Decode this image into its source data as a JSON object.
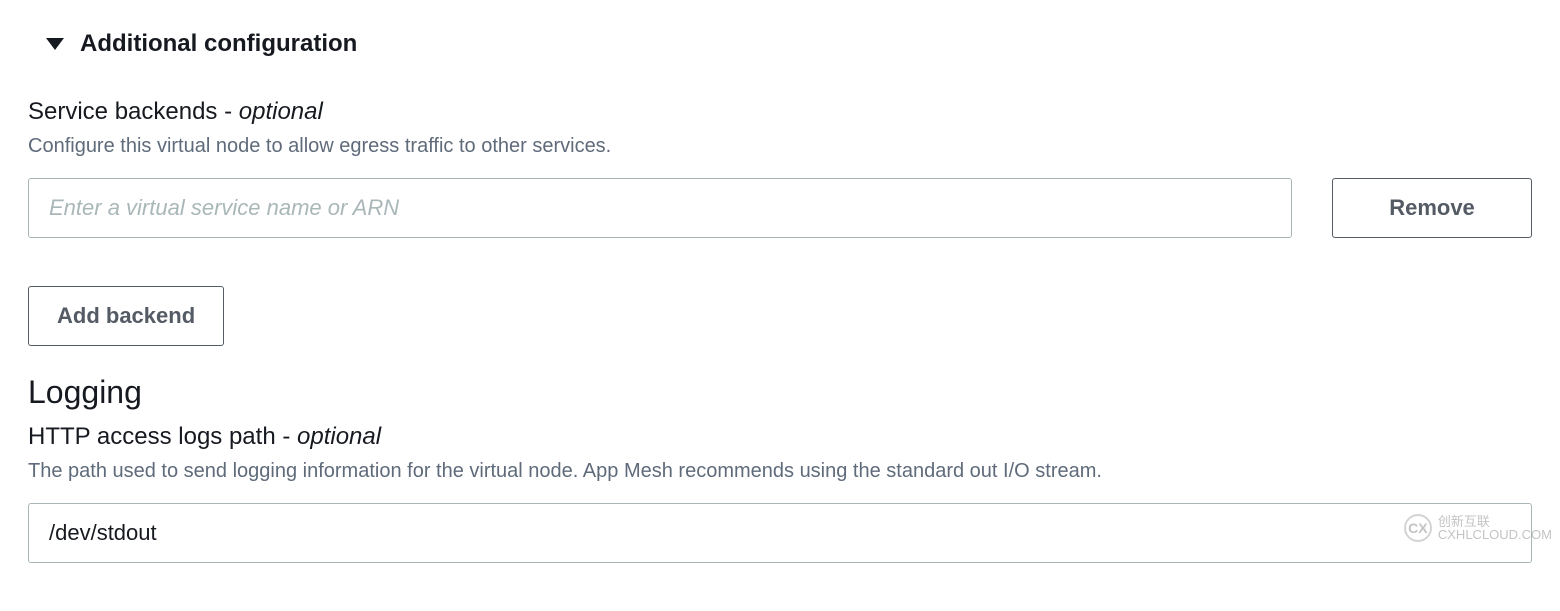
{
  "expander": {
    "title": "Additional configuration"
  },
  "backends": {
    "label_main": "Service backends - ",
    "label_optional": "optional",
    "description": "Configure this virtual node to allow egress traffic to other services.",
    "input_placeholder": "Enter a virtual service name or ARN",
    "input_value": "",
    "remove_label": "Remove",
    "add_label": "Add backend"
  },
  "logging": {
    "heading": "Logging",
    "label_main": "HTTP access logs path - ",
    "label_optional": "optional",
    "description": "The path used to send logging information for the virtual node. App Mesh recommends using the standard out I/O stream.",
    "input_value": "/dev/stdout"
  },
  "watermark": {
    "symbol": "CX",
    "text_top": "创新互联",
    "text_bottom": "CXHLCLOUD.COM"
  }
}
